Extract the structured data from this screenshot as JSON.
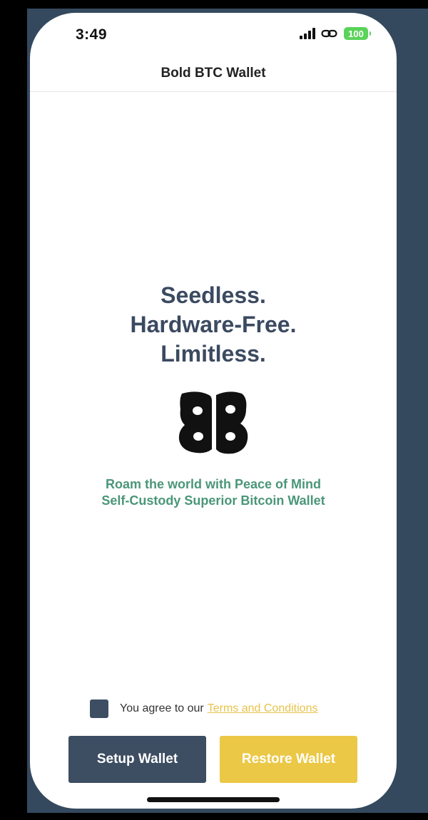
{
  "status_bar": {
    "time": "3:49",
    "battery": "100",
    "icons": [
      "signal-icon",
      "link-icon",
      "battery-icon"
    ]
  },
  "nav": {
    "title": "Bold BTC Wallet"
  },
  "hero": {
    "headline_lines": [
      "Seedless.",
      "Hardware-Free.",
      "Limitless."
    ],
    "logo_text": "BB",
    "tagline_lines": [
      "Roam the world with Peace of Mind",
      "Self-Custody Superior Bitcoin Wallet"
    ]
  },
  "terms": {
    "prefix": "You agree to our",
    "link": "Terms and Conditions",
    "checked": false
  },
  "actions": {
    "setup_label": "Setup Wallet",
    "restore_label": "Restore Wallet"
  },
  "colors": {
    "primary": "#3d4d62",
    "accent": "#ebc845",
    "tagline": "#4a9679",
    "battery": "#5ad35a"
  }
}
